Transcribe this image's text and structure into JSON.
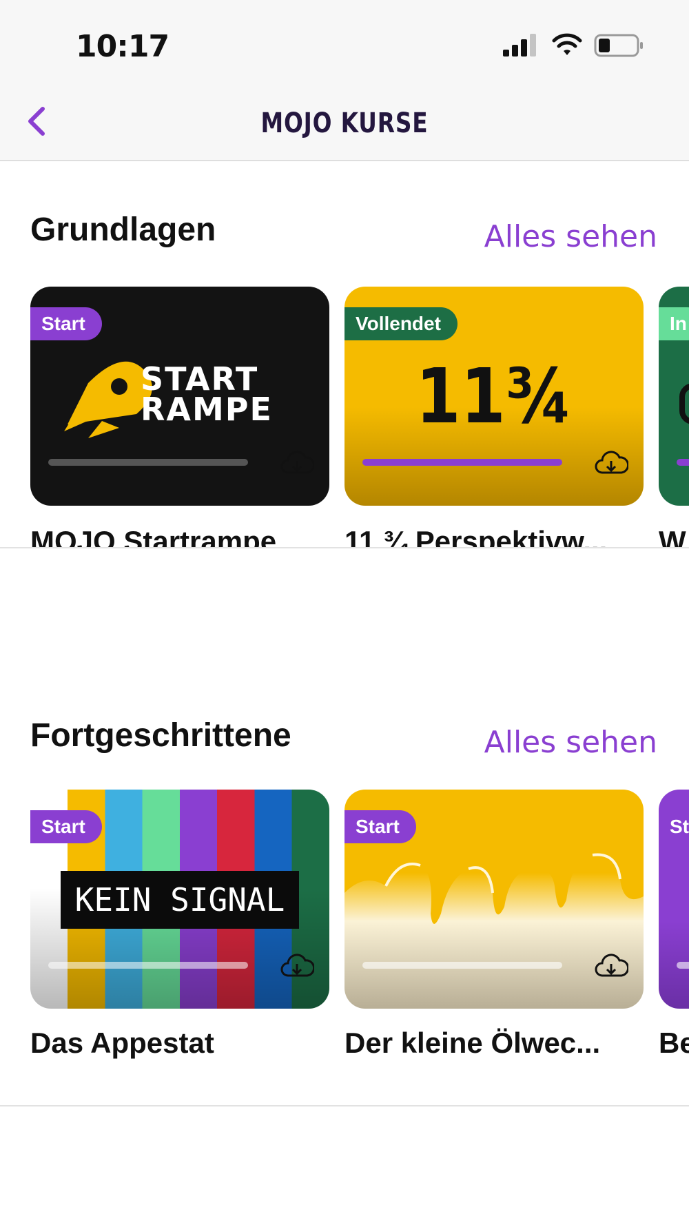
{
  "status": {
    "time": "10:17"
  },
  "nav": {
    "title": "MOJO KURSE"
  },
  "sections": [
    {
      "title": "Grundlagen",
      "see_all": "Alles sehen",
      "cards": [
        {
          "badge": "Start",
          "title": "MOJO Startrampe",
          "art_top": "START",
          "art_bottom": "RAMPE",
          "progress": 0
        },
        {
          "badge": "Vollendet",
          "title": "11 ¾ Perspektivw...",
          "art_text": "11¾",
          "progress": 1
        },
        {
          "badge": "In",
          "title": "W"
        }
      ]
    },
    {
      "title": "Fortgeschrittene",
      "see_all": "Alles sehen",
      "cards": [
        {
          "badge": "Start",
          "title": "Das Appestat",
          "art_text": "KEIN SIGNAL",
          "progress": 0
        },
        {
          "badge": "Start",
          "title": "Der kleine Ölwec...",
          "progress": 0
        },
        {
          "badge": "St",
          "title": "Be"
        }
      ]
    }
  ],
  "colors": {
    "accent": "#8a3fd1",
    "done": "#1d6e45",
    "yellow": "#f5bb00",
    "dark": "#131313"
  }
}
